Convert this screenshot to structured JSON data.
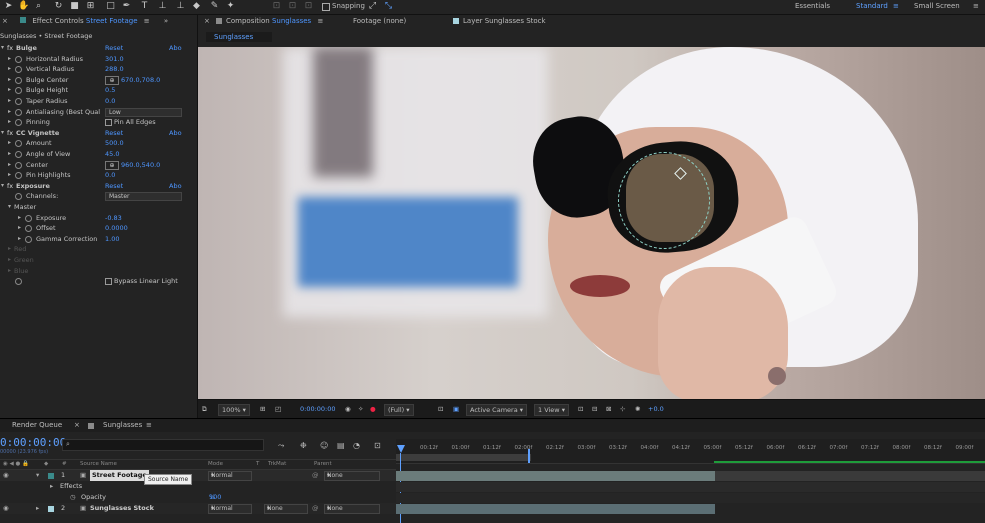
{
  "toolbar": {
    "snapping_label": "Snapping",
    "workspaces": [
      {
        "label": "Essentials",
        "active": false
      },
      {
        "label": "Standard",
        "active": true
      },
      {
        "label": "Small Screen",
        "active": false
      }
    ]
  },
  "effect_controls": {
    "tab_prefix": "Effect Controls",
    "tab_layer": "Street Footage",
    "breadcrumb": "Sunglasses • Street Footage",
    "reset_label": "Reset",
    "about_label": "Abo",
    "effects": [
      {
        "name": "Bulge",
        "params": [
          {
            "label": "Horizontal Radius",
            "value": "301.0"
          },
          {
            "label": "Vertical Radius",
            "value": "288.0"
          },
          {
            "label": "Bulge Center",
            "value": "670.0,708.0"
          },
          {
            "label": "Bulge Height",
            "value": "0.5"
          },
          {
            "label": "Taper Radius",
            "value": "0.0"
          },
          {
            "label": "Antialiasing (Best Qual",
            "value": "Low"
          },
          {
            "label": "Pinning",
            "value": "Pin All Edges"
          }
        ]
      },
      {
        "name": "CC Vignette",
        "params": [
          {
            "label": "Amount",
            "value": "500.0"
          },
          {
            "label": "Angle of View",
            "value": "45.0"
          },
          {
            "label": "Center",
            "value": "960.0,540.0"
          },
          {
            "label": "Pin Highlights",
            "value": "0.0"
          }
        ]
      },
      {
        "name": "Exposure",
        "channels_label": "Channels:",
        "channels_value": "Master",
        "master_label": "Master",
        "params": [
          {
            "label": "Exposure",
            "value": "-0.83"
          },
          {
            "label": "Offset",
            "value": "0.0000"
          },
          {
            "label": "Gamma Correction",
            "value": "1.00"
          }
        ],
        "disabled": [
          "Red",
          "Green",
          "Blue"
        ],
        "bypass_label": "Bypass Linear Light"
      }
    ]
  },
  "composition": {
    "tab_prefix": "Composition",
    "tab_name": "Sunglasses",
    "subtab": "Sunglasses",
    "footage_tab": "Footage (none)",
    "layer_tab": "Layer Sunglasses Stock"
  },
  "viewer_bar": {
    "zoom": "100%",
    "timecode": "0:00:00:00",
    "resolution": "(Full)",
    "camera": "Active Camera",
    "views": "1 View",
    "exposure": "+0.0"
  },
  "timeline": {
    "render_queue_tab": "Render Queue",
    "comp_tab": "Sunglasses",
    "timecode": "0:00:00:00",
    "fps": "00000 (23.976 fps)",
    "columns": [
      "Source Name",
      "Mode",
      "T",
      "TrkMat",
      "Parent"
    ],
    "ruler_ticks": [
      "00:12f",
      "01:00f",
      "01:12f",
      "02:00f",
      "02:12f",
      "03:00f",
      "03:12f",
      "04:00f",
      "04:12f",
      "05:00f",
      "05:12f",
      "06:00f",
      "06:12f",
      "07:00f",
      "07:12f",
      "08:00f",
      "08:12f",
      "09:00f"
    ],
    "layers": [
      {
        "num": "1",
        "name": "Street Footage",
        "mode": "Normal",
        "parent": "None"
      },
      {
        "num": "2",
        "name": "Sunglasses Stock",
        "mode": "Normal",
        "trkmat": "None",
        "parent": "None"
      }
    ],
    "effects_label": "Effects",
    "opacity_label": "Opacity",
    "opacity_value": "100",
    "opacity_unit": "%",
    "tooltip": "Source Name"
  }
}
